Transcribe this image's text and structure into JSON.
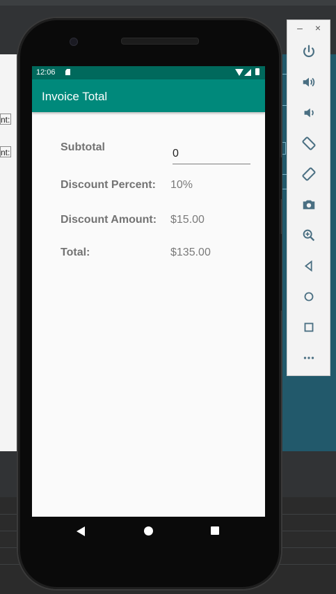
{
  "status_bar": {
    "time": "12:06"
  },
  "app_bar": {
    "title": "Invoice Total"
  },
  "form": {
    "subtotal_label": "Subtotal",
    "subtotal_value": "0",
    "discount_percent_label": "Discount Percent:",
    "discount_percent_value": "10%",
    "discount_amount_label": "Discount Amount:",
    "discount_amount_value": "$15.00",
    "total_label": "Total:",
    "total_value": "$135.00"
  },
  "design_surface": {
    "label_1": "nt:",
    "label_2": "nt:"
  },
  "emulator_controls": {
    "minimize": "–",
    "close": "×",
    "tools": [
      "power-icon",
      "volume-up-icon",
      "volume-down-icon",
      "rotate-left-icon",
      "rotate-right-icon",
      "camera-icon",
      "zoom-icon",
      "back-icon",
      "home-icon",
      "overview-icon",
      "more-icon"
    ]
  },
  "colors": {
    "status_bar": "#00695c",
    "app_bar": "#00897b",
    "screen_bg": "#fafafa",
    "toolbar_icon": "#4a6f82"
  }
}
